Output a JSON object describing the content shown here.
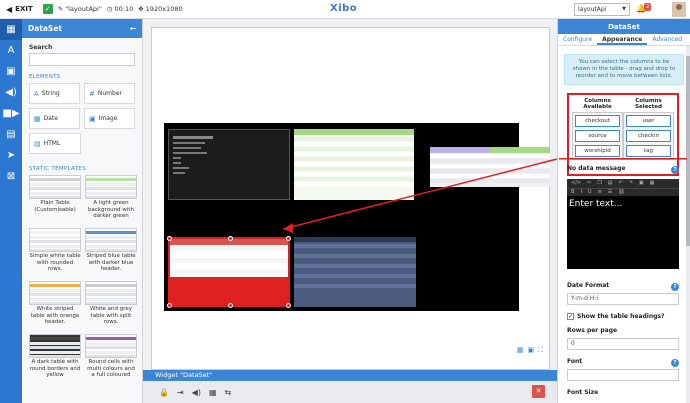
{
  "topbar": {
    "exit_label": "EXIT",
    "layout_name": "\"layoutApi\"",
    "duration": "00:10",
    "resolution": "1920x1080",
    "logo": "Xibo",
    "layout_select": "layoutApi",
    "notification_count": "2"
  },
  "left_panel": {
    "title": "DataSet",
    "search_label": "Search",
    "elements_heading": "ELEMENTS",
    "elements": [
      {
        "label": "String",
        "icon": "text-icon"
      },
      {
        "label": "Number",
        "icon": "number-icon"
      },
      {
        "label": "Date",
        "icon": "calendar-icon"
      },
      {
        "label": "Image",
        "icon": "image-icon"
      },
      {
        "label": "HTML",
        "icon": "code-icon"
      }
    ],
    "templates_heading": "STATIC TEMPLATES",
    "templates": [
      {
        "name": "Plain Table (Customisable)",
        "accent": "#ffffff"
      },
      {
        "name": "A light green background with darker green",
        "accent": "#b5e3a1"
      },
      {
        "name": "Simple white table with rounded rows.",
        "accent": "#f2f2f2"
      },
      {
        "name": "Striped blue table with darker blue header.",
        "accent": "#5b8fd8"
      },
      {
        "name": "White striped table with orange header.",
        "accent": "#f0ad4e"
      },
      {
        "name": "White and grey table with split rows.",
        "accent": "#c8ccd2"
      },
      {
        "name": "A dark table with round borders and yellow",
        "accent": "#444444"
      },
      {
        "name": "Round cells with multi colours and a full coloured",
        "accent": "#9b59b6"
      }
    ]
  },
  "stage": {
    "widgets": [
      {
        "name": "ticker-list-widget"
      },
      {
        "name": "green-table-widget"
      },
      {
        "name": "lilac-table-widget"
      },
      {
        "name": "selected-dataset-widget"
      },
      {
        "name": "blue-table-widget"
      }
    ]
  },
  "center_bottom": {
    "widget_label": "Widget",
    "widget_name": "\"DataSet\""
  },
  "right_panel": {
    "title": "DataSet",
    "tabs": [
      "Configure",
      "Appearance",
      "Advanced"
    ],
    "active_tab": "Appearance",
    "info_text": "You can select the columns to be shown in the table - drag and drop to reorder and to move between lists.",
    "columns_available_title": "Columns Available",
    "columns_selected_title": "Columns Selected",
    "columns_available": [
      "checkout",
      "source",
      "worshipid"
    ],
    "columns_selected": [
      "user",
      "checkin",
      "tag"
    ],
    "no_data_label": "No data message",
    "editor_placeholder": "Enter text...",
    "date_format_label": "Date Format",
    "date_format_value": "Y-m-d H:i",
    "show_headings_label": "Show the table headings?",
    "rows_per_page_label": "Rows per page",
    "rows_per_page_value": "0",
    "font_label": "Font",
    "font_size_label": "Font Size"
  },
  "colors": {
    "accent": "#3c86d6",
    "highlight": "#e02020"
  }
}
